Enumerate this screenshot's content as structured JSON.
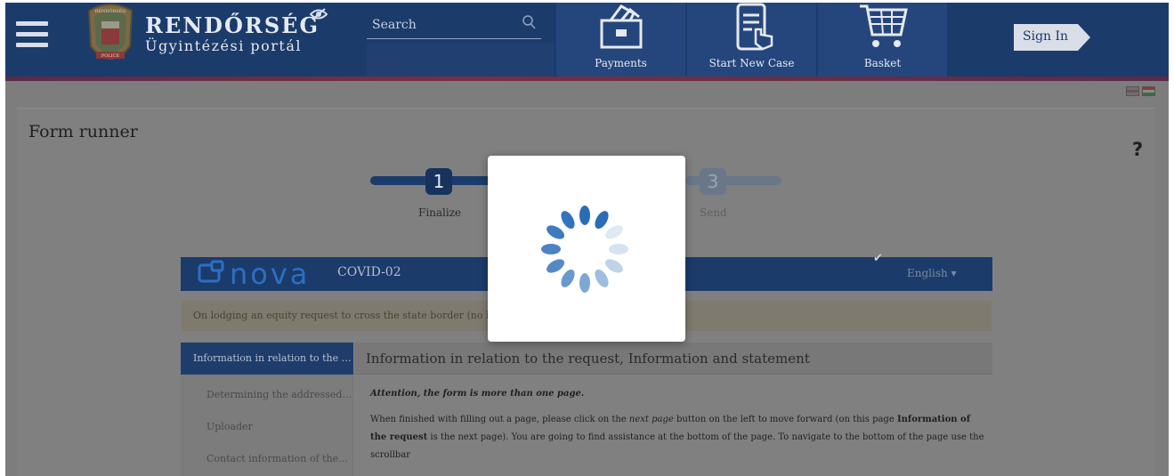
{
  "header": {
    "brand_title": "RENDŐRSÉG",
    "brand_subtitle": "Ügyintézési portál",
    "logo_text_top": "RENDŐRSÉG",
    "logo_text_bottom": "POLICE",
    "search_placeholder": "Search",
    "nav": [
      {
        "label": "Payments",
        "icon": "wallet-icon"
      },
      {
        "label": "Start New Case",
        "icon": "tablet-touch-icon"
      },
      {
        "label": "Basket",
        "icon": "shopping-cart-icon"
      }
    ],
    "signin_label": "Sign In"
  },
  "page": {
    "title": "Form runner",
    "help": "?",
    "steps": [
      {
        "number": "1",
        "label": "Finalize"
      },
      {
        "number": "3",
        "label": "Send"
      }
    ]
  },
  "nova": {
    "logo_text": "nova",
    "code": "COVID-02",
    "check": "✔",
    "language": "English ▾"
  },
  "notice": "On lodging an equity request to cross the state border (no login re",
  "left_nav": {
    "active": "Information in relation to the …",
    "items": [
      "Determining the addressed…",
      "Uploader",
      "Contact information of the…"
    ]
  },
  "main": {
    "heading": "Information in relation to the request, Information and statement",
    "attention": "Attention, the form is more than one page.",
    "para_1": "When finished with filling out a page, please click on the ",
    "para_em": "next page",
    "para_2": " button on the left to move forward (on this page ",
    "para_b": "Information of the request",
    "para_3": " is the next page). You are going to find assistance at the bottom of the page. To navigate to the bottom of the page use the scrollbar"
  },
  "colors": {
    "header_bg": "#1b3b6b",
    "accent_strip": "#7a2f44",
    "spinner": "#2a6cb8"
  }
}
